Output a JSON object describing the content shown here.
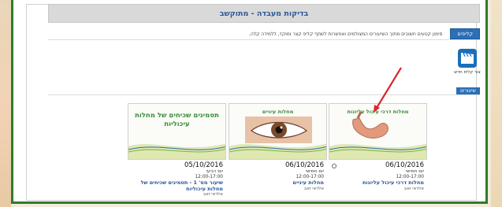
{
  "page": {
    "title": "בדיקות מעבדה - מתוקשב"
  },
  "row1": {
    "tab_label": "קליפים",
    "text": "סימון קטעים חשובים מתוך השיעורים המצולמים ואפשרות לשתף קליפ קצר ומוקד, ללמידה קלה."
  },
  "new_clip": {
    "label": "צור קליפ חדש",
    "icon": "clapperboard-icon"
  },
  "lessons": {
    "tab_label": "שיעורים"
  },
  "cards": [
    {
      "thumb_title": "מחלות דרכי עיכול עליונות",
      "date": "06/10/2016",
      "day": "יום חמישי",
      "time": "12:00-17:00",
      "title": "מחלות דרכי עיכול עליונות",
      "author": "אלדאי זאב"
    },
    {
      "thumb_title": "מחלות עיניים",
      "date": "06/10/2016",
      "day": "יום חמישי",
      "time": "12:00-17:00",
      "title": "מחלות עיניים",
      "author": "אלדאי זאב"
    },
    {
      "thumb_title": "תסמינים שכיחים של מחלות עיכוליות",
      "date": "05/10/2016",
      "day": "יום רביעי",
      "time": "12:00-17:00",
      "title": "שיעור מס' 1 - תסמינים שכיחים של מחלות עיכוליות",
      "author": "אלדאי זאב"
    }
  ],
  "colors": {
    "frame": "#2c7d2c",
    "accent_blue": "#2b6fb6",
    "arrow": "#d9262c"
  }
}
